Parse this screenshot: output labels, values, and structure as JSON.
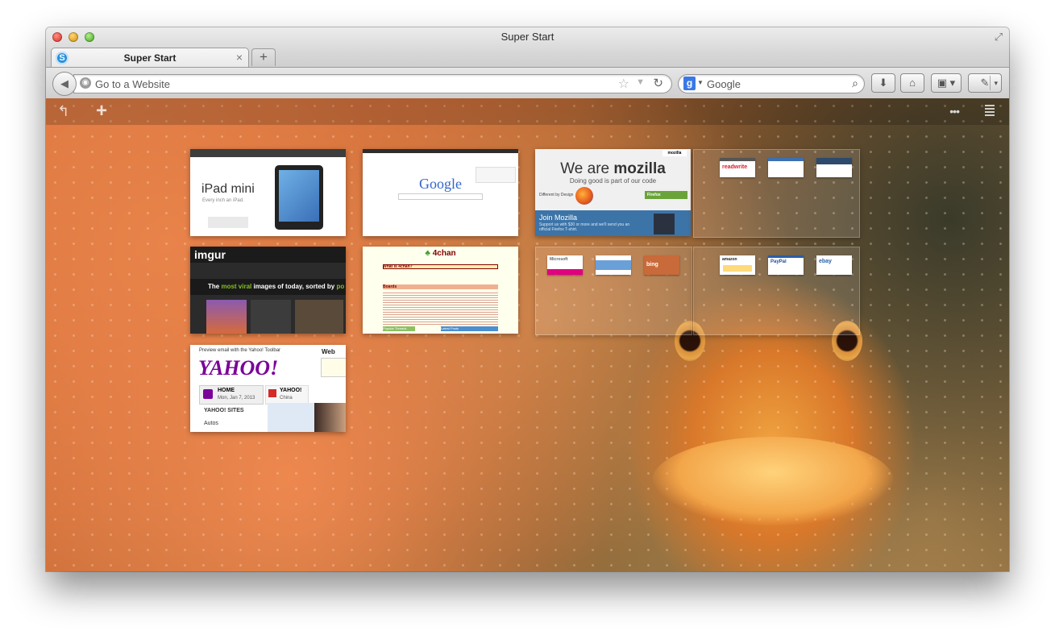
{
  "window": {
    "title": "Super Start"
  },
  "tab": {
    "title": "Super Start",
    "favicon_letter": "S"
  },
  "navbar": {
    "url_placeholder": "Go to a Website",
    "search_placeholder": "Google",
    "search_engine_letter": "g"
  },
  "icons": {
    "back": "back-arrow-icon",
    "globe": "globe-icon",
    "star": "bookmark-star-icon",
    "reload": "reload-icon",
    "search": "magnifier-icon",
    "download": "download-icon",
    "home": "home-icon",
    "bookmarks": "bookmarks-icon",
    "addon": "addon-icon"
  },
  "thumbnails": {
    "apple": {
      "title": "iPad mini",
      "subtitle": "Every inch an iPad."
    },
    "google": {
      "logo": "Google"
    },
    "mozilla": {
      "headline_light": "We are ",
      "headline_bold": "mozilla",
      "tagline": "Doing good is part of our code",
      "join": "Join Mozilla",
      "join_text": "Support us with $30 or more and we'll send you an official Firefox T-shirt.",
      "brand": "mozilla",
      "firefox_cta": "Firefox",
      "design": "Different by Design"
    },
    "imgur": {
      "brand": "imgur",
      "banner_pre": "The ",
      "banner_hl": "most viral",
      "banner_post": " images of today, sorted by ",
      "banner_tail": "po"
    },
    "fourchan": {
      "brand": "4chan",
      "what": "What is 4chan?",
      "boards": "Boards",
      "popular": "Popular Threads",
      "latest": "Latest Posts"
    },
    "yahoo": {
      "preview": "Preview email with the Yahoo! Toolbar",
      "web": "Web",
      "logo": "YAHOO!",
      "home_label": "HOME",
      "home_date": "Mon, Jan 7, 2013",
      "china_label": "YAHOO!",
      "china_sub": "China",
      "sites": "YAHOO! SITES",
      "autos": "Autos"
    }
  },
  "folders": [
    {
      "minis": [
        "readwrite",
        "",
        ""
      ]
    },
    {
      "minis": [
        "Microsoft",
        "",
        "bing"
      ]
    },
    {
      "minis": [
        "amazon",
        "PayPal",
        "ebay"
      ]
    }
  ],
  "colors": {
    "accent": "#2a8fd8",
    "mozilla_blue": "#3c74a8",
    "imgur_green": "#85bf25",
    "yahoo_purple": "#7b0099",
    "fourchan_red": "#800000"
  }
}
